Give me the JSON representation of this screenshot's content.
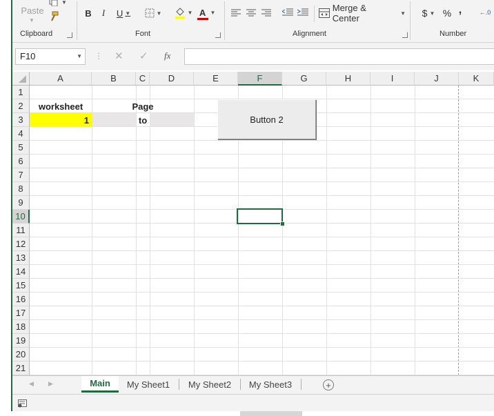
{
  "ribbon": {
    "clipboard": {
      "paste_label": "Paste",
      "group_label": "Clipboard"
    },
    "font": {
      "bold": "B",
      "italic": "I",
      "underline": "U",
      "font_color": "A",
      "group_label": "Font"
    },
    "alignment": {
      "merge_center_label": "Merge & Center",
      "group_label": "Alignment"
    },
    "number": {
      "currency": "$",
      "percent": "%",
      "comma": ",",
      "group_label": "Number"
    }
  },
  "formula_bar": {
    "name_box": "F10",
    "cancel": "✕",
    "enter": "✓",
    "fx": "fx",
    "formula": ""
  },
  "grid": {
    "columns": [
      "A",
      "B",
      "C",
      "D",
      "E",
      "F",
      "G",
      "H",
      "I",
      "J",
      "K"
    ],
    "selected_column": "F",
    "rows": [
      "1",
      "2",
      "3",
      "4",
      "5",
      "6",
      "7",
      "8",
      "9",
      "10",
      "11",
      "12",
      "13",
      "14",
      "15",
      "16",
      "17",
      "18",
      "19",
      "20",
      "21"
    ],
    "selected_row": "10",
    "cells": {
      "A2": "worksheet",
      "C2": "Page",
      "A3": "1",
      "C3": "to"
    },
    "button_label": "Button 2"
  },
  "sheet_tabs": [
    "Main",
    "My Sheet1",
    "My Sheet2",
    "My Sheet3"
  ],
  "active_tab": "Main",
  "colors": {
    "accent": "#1e6b3e",
    "highlight": "#ffff00",
    "shaded_cell": "#e8e6e6"
  }
}
